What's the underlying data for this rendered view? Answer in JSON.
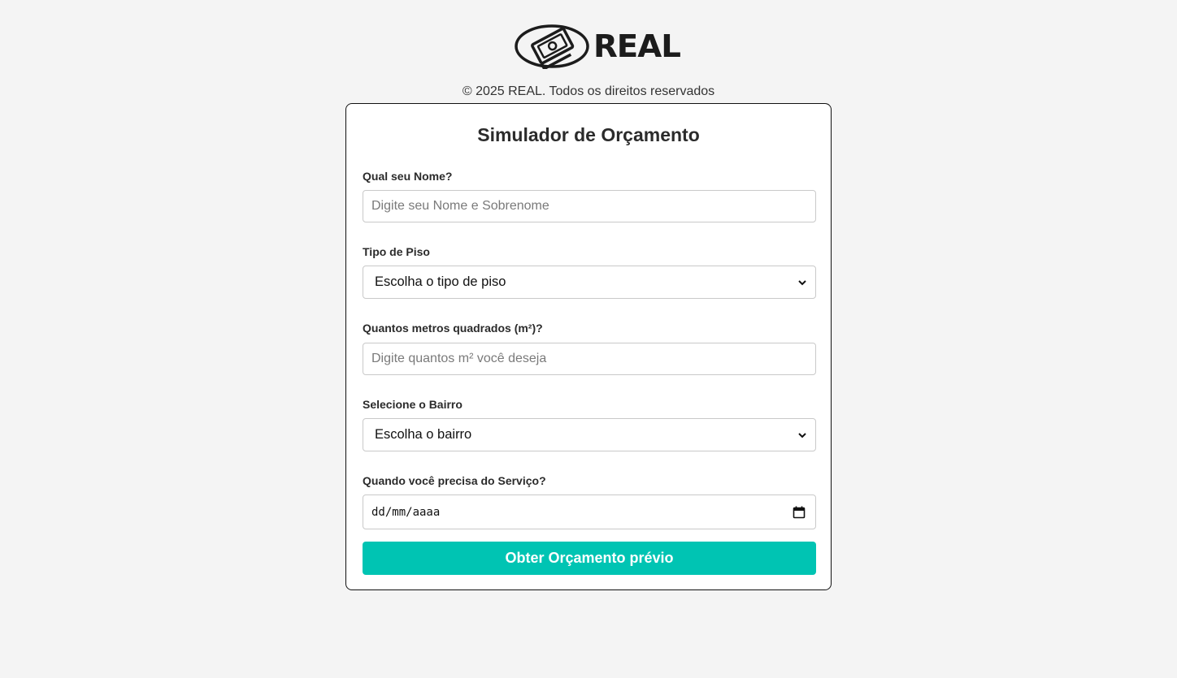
{
  "brand": {
    "logo_icon": "wallet-money-logo-icon",
    "name": "REAL",
    "accent_color": "#00c4b3"
  },
  "footer": {
    "copyright": "© 2025 REAL. Todos os direitos reservados"
  },
  "form": {
    "title": "Simulador de Orçamento",
    "name": {
      "label": "Qual seu Nome?",
      "placeholder": "Digite seu Nome e Sobrenome",
      "value": ""
    },
    "floor_type": {
      "label": "Tipo de Piso",
      "selected": "Escolha o tipo de piso"
    },
    "area": {
      "label": "Quantos metros quadrados (m²)?",
      "placeholder": "Digite quantos m² você deseja",
      "value": ""
    },
    "neighborhood": {
      "label": "Selecione o Bairro",
      "selected": "Escolha o bairro"
    },
    "date": {
      "label": "Quando você precisa do Serviço?",
      "value": "dd/mm/aaaa"
    },
    "submit_label": "Obter Orçamento prévio"
  }
}
